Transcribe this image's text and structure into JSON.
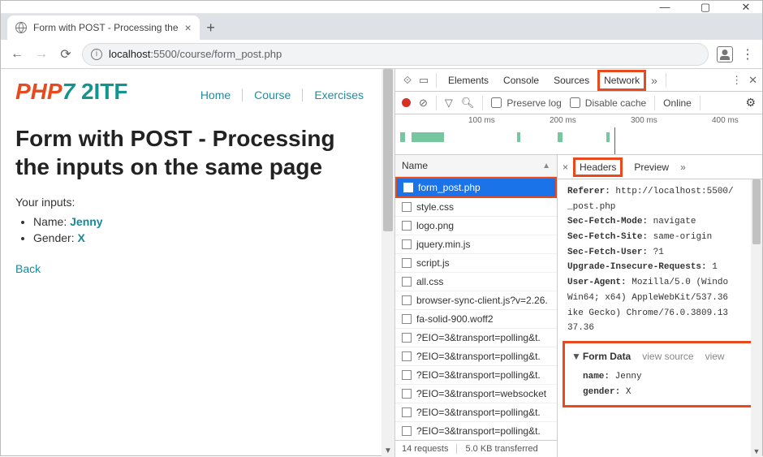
{
  "window": {
    "title": "Form with POST - Processing the"
  },
  "addr": {
    "host": "localhost",
    "port": "5500",
    "path": "/course/form_post.php",
    "display": "localhost:5500/course/form_post.php"
  },
  "page": {
    "logo_main": "PHP",
    "logo_version": "7",
    "logo_sub": "2ITF",
    "nav": [
      "Home",
      "Course",
      "Exercises"
    ],
    "heading": "Form with POST - Processing the inputs on the same page",
    "inputs_label": "Your inputs:",
    "inputs": [
      {
        "label": "Name:",
        "value": "Jenny"
      },
      {
        "label": "Gender:",
        "value": "X"
      }
    ],
    "back": "Back"
  },
  "devtools": {
    "tabs": [
      "Elements",
      "Console",
      "Sources",
      "Network"
    ],
    "active_tab": "Network",
    "toolbar": {
      "preserve_log": "Preserve log",
      "disable_cache": "Disable cache",
      "online": "Online"
    },
    "timeline_ticks": [
      "100 ms",
      "200 ms",
      "300 ms",
      "400 ms"
    ],
    "reqlist": {
      "header": "Name",
      "requests": [
        "form_post.php",
        "style.css",
        "logo.png",
        "jquery.min.js",
        "script.js",
        "all.css",
        "browser-sync-client.js?v=2.26.",
        "fa-solid-900.woff2",
        "?EIO=3&transport=polling&t.",
        "?EIO=3&transport=polling&t.",
        "?EIO=3&transport=polling&t.",
        "?EIO=3&transport=websocket",
        "?EIO=3&transport=polling&t.",
        "?EIO=3&transport=polling&t."
      ],
      "selected": 0,
      "footer_requests": "14 requests",
      "footer_transferred": "5.0 KB transferred"
    },
    "detail": {
      "tabs": [
        "Headers",
        "Preview"
      ],
      "active": "Headers",
      "headers": [
        {
          "k": "Referer:",
          "v": "http://localhost:5500/"
        },
        {
          "k": "",
          "v": "_post.php"
        },
        {
          "k": "Sec-Fetch-Mode:",
          "v": "navigate"
        },
        {
          "k": "Sec-Fetch-Site:",
          "v": "same-origin"
        },
        {
          "k": "Sec-Fetch-User:",
          "v": "?1"
        },
        {
          "k": "Upgrade-Insecure-Requests:",
          "v": "1"
        },
        {
          "k": "User-Agent:",
          "v": "Mozilla/5.0 (Windo"
        },
        {
          "k": "",
          "v": "Win64; x64) AppleWebKit/537.36"
        },
        {
          "k": "",
          "v": "ike Gecko) Chrome/76.0.3809.13"
        },
        {
          "k": "",
          "v": "37.36"
        }
      ],
      "form_data": {
        "title": "Form Data",
        "view_source": "view source",
        "view": "view",
        "items": [
          {
            "k": "name:",
            "v": "Jenny"
          },
          {
            "k": "gender:",
            "v": "X"
          }
        ]
      }
    }
  }
}
